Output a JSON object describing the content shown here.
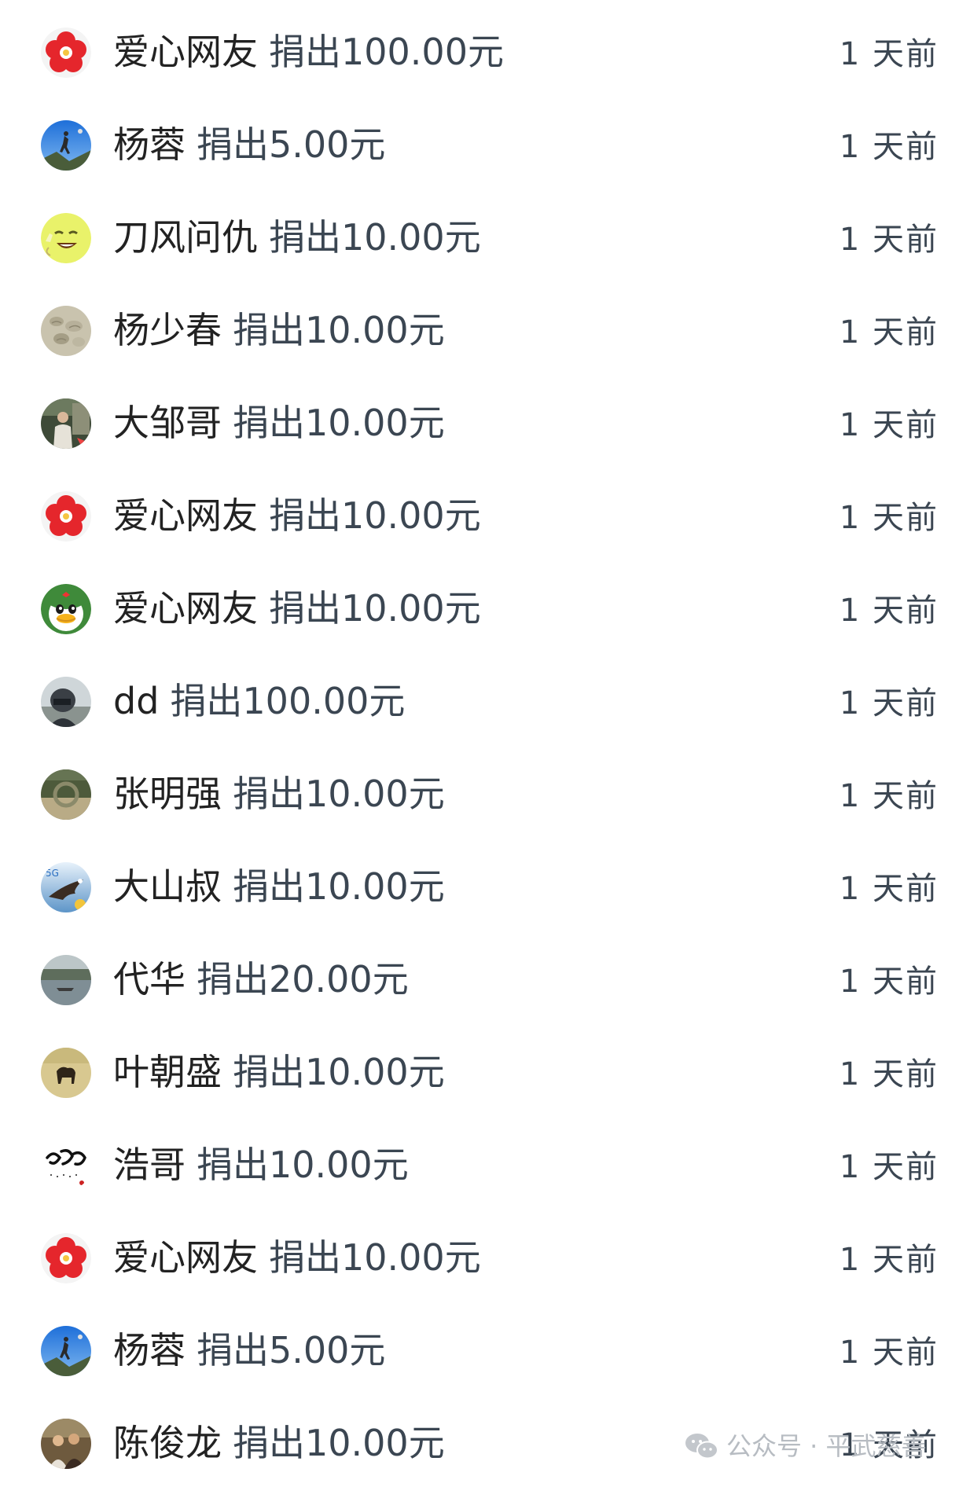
{
  "donations": [
    {
      "name": "爱心网友",
      "amount": "捐出100.00元",
      "time": "1 天前",
      "avatar": "red-flower-avatar"
    },
    {
      "name": "杨蓉",
      "amount": "捐出5.00元",
      "time": "1 天前",
      "avatar": "sky-climber-avatar"
    },
    {
      "name": "刀风问仇",
      "amount": "捐出10.00元",
      "time": "1 天前",
      "avatar": "smiley-peace-avatar"
    },
    {
      "name": "杨少春",
      "amount": "捐出10.00元",
      "time": "1 天前",
      "avatar": "stone-texture-avatar"
    },
    {
      "name": "大邹哥",
      "amount": "捐出10.00元",
      "time": "1 天前",
      "avatar": "man-photo-avatar"
    },
    {
      "name": "爱心网友",
      "amount": "捐出10.00元",
      "time": "1 天前",
      "avatar": "red-flower-avatar"
    },
    {
      "name": "爱心网友",
      "amount": "捐出10.00元",
      "time": "1 天前",
      "avatar": "qq-penguin-avatar"
    },
    {
      "name": "dd",
      "amount": "捐出100.00元",
      "time": "1 天前",
      "avatar": "helmet-rider-avatar"
    },
    {
      "name": "张明强",
      "amount": "捐出10.00元",
      "time": "1 天前",
      "avatar": "landscape-circle-avatar"
    },
    {
      "name": "大山叔",
      "amount": "捐出10.00元",
      "time": "1 天前",
      "avatar": "eagle-5g-avatar"
    },
    {
      "name": "代华",
      "amount": "捐出20.00元",
      "time": "1 天前",
      "avatar": "lake-boat-avatar"
    },
    {
      "name": "叶朝盛",
      "amount": "捐出10.00元",
      "time": "1 天前",
      "avatar": "dog-field-avatar"
    },
    {
      "name": "浩哥",
      "amount": "捐出10.00元",
      "time": "1 天前",
      "avatar": "calligraphy-avatar"
    },
    {
      "name": "爱心网友",
      "amount": "捐出10.00元",
      "time": "1 天前",
      "avatar": "red-flower-avatar"
    },
    {
      "name": "杨蓉",
      "amount": "捐出5.00元",
      "time": "1 天前",
      "avatar": "sky-climber-avatar"
    },
    {
      "name": "陈俊龙",
      "amount": "捐出10.00元",
      "time": "1 天前",
      "avatar": "group-photo-avatar"
    }
  ],
  "watermark": {
    "text": "公众号 · 平武慈善",
    "icon": "wechat-icon"
  }
}
